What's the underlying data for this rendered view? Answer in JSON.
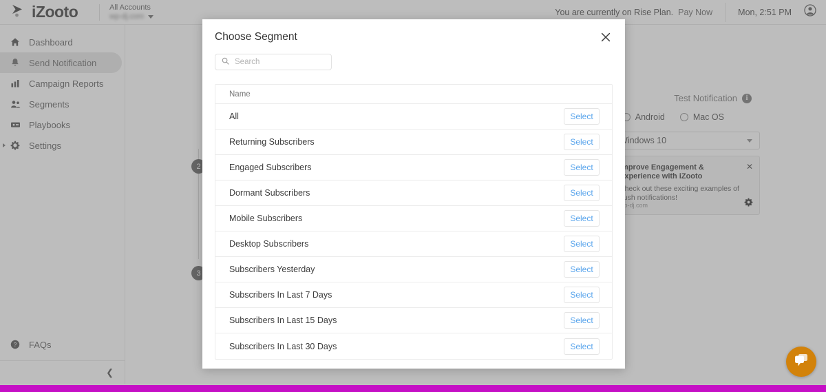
{
  "header": {
    "brand": "iZooto",
    "brand_icon": "izooto-arrow-logo",
    "account_label": "All Accounts",
    "account_name": "wp-dj.com",
    "account_caret_icon": "caret-down-icon",
    "plan_text": "You are currently on Rise Plan.",
    "pay_now": "Pay Now",
    "clock": "Mon, 2:51 PM",
    "avatar_icon": "user-avatar-icon",
    "pay_now_color": "#e8412c"
  },
  "sidebar": {
    "items": [
      {
        "label": "Dashboard",
        "icon": "home-icon",
        "active": false
      },
      {
        "label": "Send Notification",
        "icon": "bell-icon",
        "active": true
      },
      {
        "label": "Campaign Reports",
        "icon": "bar-chart-icon",
        "active": false
      },
      {
        "label": "Segments",
        "icon": "people-icon",
        "active": false
      },
      {
        "label": "Playbooks",
        "icon": "playbook-card-icon",
        "active": false
      },
      {
        "label": "Settings",
        "icon": "gear-icon",
        "active": false,
        "expandable": true
      }
    ],
    "faq": {
      "label": "FAQs",
      "icon": "question-circle-icon"
    },
    "collapse_icon": "chevron-left-icon",
    "active_color": "#2f6fc4"
  },
  "main": {
    "steps": [
      "2",
      "3"
    ],
    "test_notification": "Test Notification",
    "test_notification_info_icon": "info-icon",
    "platform_options": [
      "Android",
      "Mac OS"
    ],
    "os_select_value": "Windows 10",
    "os_select_caret_icon": "caret-down-icon",
    "preview": {
      "title": "Improve Engagement & Experience with iZooto",
      "body": "Check out these exciting examples of push notifications!",
      "source": "wp-dj.com",
      "close_icon": "close-icon",
      "gear_icon": "gear-icon"
    },
    "chat_icon": "chat-bubble-icon",
    "chat_color": "#d2820a",
    "bottom_bar_color": "#c50fc5"
  },
  "modal": {
    "title": "Choose Segment",
    "close_icon": "close-icon",
    "search": {
      "placeholder": "Search",
      "value": "",
      "icon": "search-icon"
    },
    "table": {
      "column_header": "Name",
      "select_label": "Select",
      "rows": [
        {
          "name": "All"
        },
        {
          "name": "Returning Subscribers"
        },
        {
          "name": "Engaged Subscribers"
        },
        {
          "name": "Dormant Subscribers"
        },
        {
          "name": "Mobile Subscribers"
        },
        {
          "name": "Desktop Subscribers"
        },
        {
          "name": "Subscribers Yesterday"
        },
        {
          "name": "Subscribers In Last 7 Days"
        },
        {
          "name": "Subscribers In Last 15 Days"
        },
        {
          "name": "Subscribers In Last 30 Days"
        }
      ]
    },
    "select_link_color": "#5aa5ec"
  }
}
